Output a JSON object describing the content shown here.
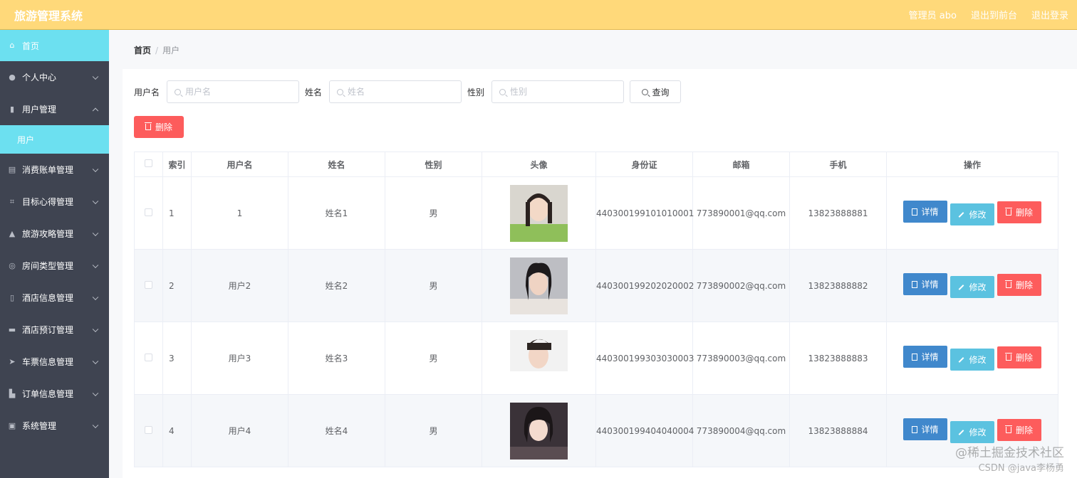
{
  "app": {
    "title": "旅游管理系统"
  },
  "topbar": {
    "admin_label": "管理员 abo",
    "front_link": "退出到前台",
    "logout_link": "退出登录"
  },
  "sidebar": {
    "items": [
      {
        "label": "首页",
        "icon": "home-icon"
      },
      {
        "label": "个人中心",
        "icon": "user-icon"
      },
      {
        "label": "用户管理",
        "icon": "users-icon"
      },
      {
        "label": "用户",
        "icon": ""
      },
      {
        "label": "消费账单管理",
        "icon": "chart-icon"
      },
      {
        "label": "目标心得管理",
        "icon": "crop-icon"
      },
      {
        "label": "旅游攻略管理",
        "icon": "guide-icon"
      },
      {
        "label": "房间类型管理",
        "icon": "compass-icon"
      },
      {
        "label": "酒店信息管理",
        "icon": "phone-icon"
      },
      {
        "label": "酒店预订管理",
        "icon": "message-icon"
      },
      {
        "label": "车票信息管理",
        "icon": "send-icon"
      },
      {
        "label": "订单信息管理",
        "icon": "bar-chart-icon"
      },
      {
        "label": "系统管理",
        "icon": "clipboard-icon"
      }
    ]
  },
  "breadcrumb": {
    "home": "首页",
    "current": "用户"
  },
  "search": {
    "username_label": "用户名",
    "username_placeholder": "用户名",
    "name_label": "姓名",
    "name_placeholder": "姓名",
    "gender_label": "性别",
    "gender_placeholder": "性别",
    "query_button": "查询"
  },
  "actions": {
    "delete_button": "删除"
  },
  "table": {
    "headers": [
      "",
      "索引",
      "用户名",
      "姓名",
      "性别",
      "头像",
      "身份证",
      "邮箱",
      "手机",
      "操作"
    ],
    "rows": [
      {
        "index": "1",
        "username": "1",
        "name": "姓名1",
        "gender": "男",
        "id_card": "440300199101010001",
        "email": "773890001@qq.com",
        "phone": "13823888881"
      },
      {
        "index": "2",
        "username": "用户2",
        "name": "姓名2",
        "gender": "男",
        "id_card": "440300199202020002",
        "email": "773890002@qq.com",
        "phone": "13823888882"
      },
      {
        "index": "3",
        "username": "用户3",
        "name": "姓名3",
        "gender": "男",
        "id_card": "440300199303030003",
        "email": "773890003@qq.com",
        "phone": "13823888883"
      },
      {
        "index": "4",
        "username": "用户4",
        "name": "姓名4",
        "gender": "男",
        "id_card": "440300199404040004",
        "email": "773890004@qq.com",
        "phone": "13823888884"
      }
    ],
    "op_detail": "详情",
    "op_edit": "修改",
    "op_delete": "删除"
  },
  "watermark": {
    "line1": "@稀土掘金技术社区",
    "line2": "CSDN @java李杨勇"
  },
  "colors": {
    "topbar": "#ffd97a",
    "sidebar": "#3f4451",
    "active": "#6ce0f0",
    "primary": "#4088cc",
    "info": "#5bc2e0",
    "danger": "#fd5c5c"
  }
}
